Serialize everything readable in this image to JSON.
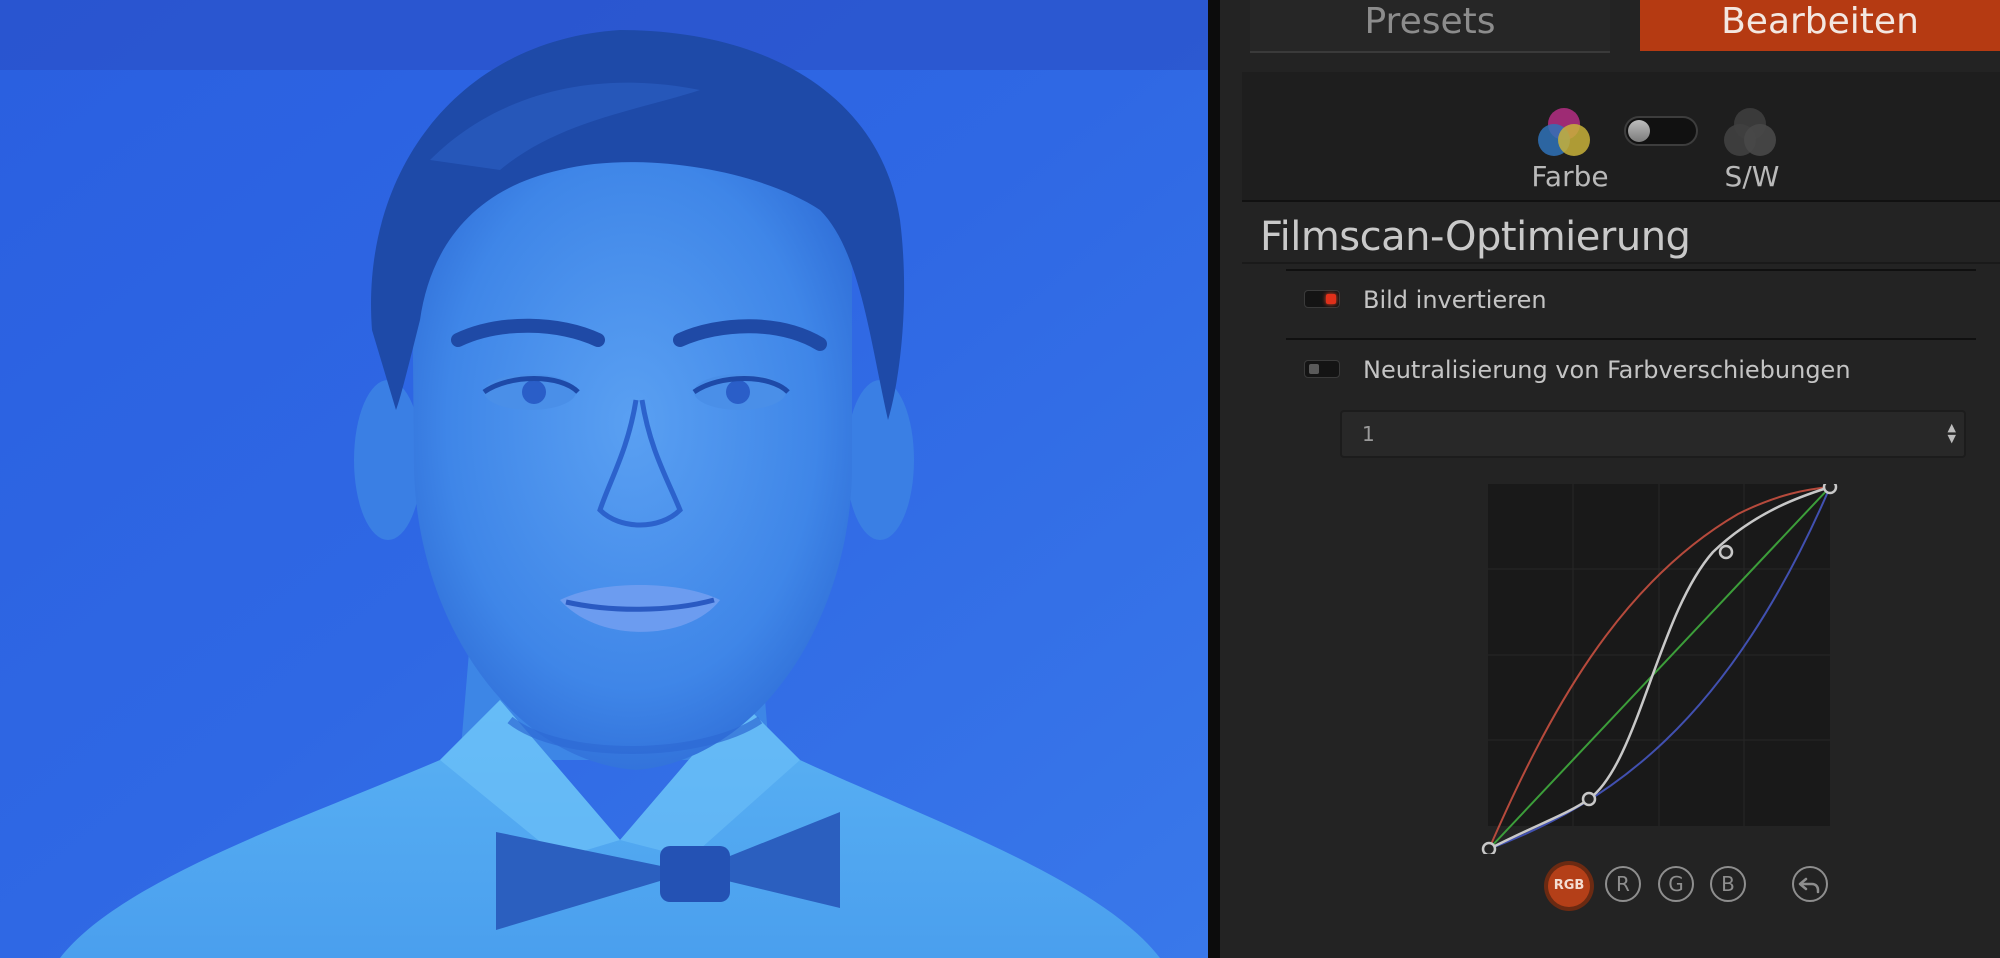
{
  "tabs": {
    "presets": "Presets",
    "edit": "Bearbeiten",
    "active": "edit"
  },
  "mode": {
    "color_label": "Farbe",
    "bw_label": "S/W",
    "selected": "Farbe"
  },
  "section": {
    "title": "Filmscan-Optimierung",
    "invert": {
      "label": "Bild invertieren",
      "enabled": true
    },
    "neutralize": {
      "label": "Neutralisierung von Farbverschiebungen",
      "enabled": false
    },
    "select": {
      "value": "1"
    }
  },
  "curve": {
    "channels": [
      "RGB",
      "R",
      "G",
      "B"
    ],
    "active_channel": "RGB",
    "reset_icon": "undo-arrow-icon",
    "colors": {
      "red": "#b64a3c",
      "green": "#3c9e3a",
      "blue": "#4150b0",
      "rgb": "#c8c8c8"
    }
  },
  "icons": {
    "color_mode": "color-circles-icon",
    "bw_mode": "gray-circles-icon"
  },
  "accent": "#b53a12"
}
